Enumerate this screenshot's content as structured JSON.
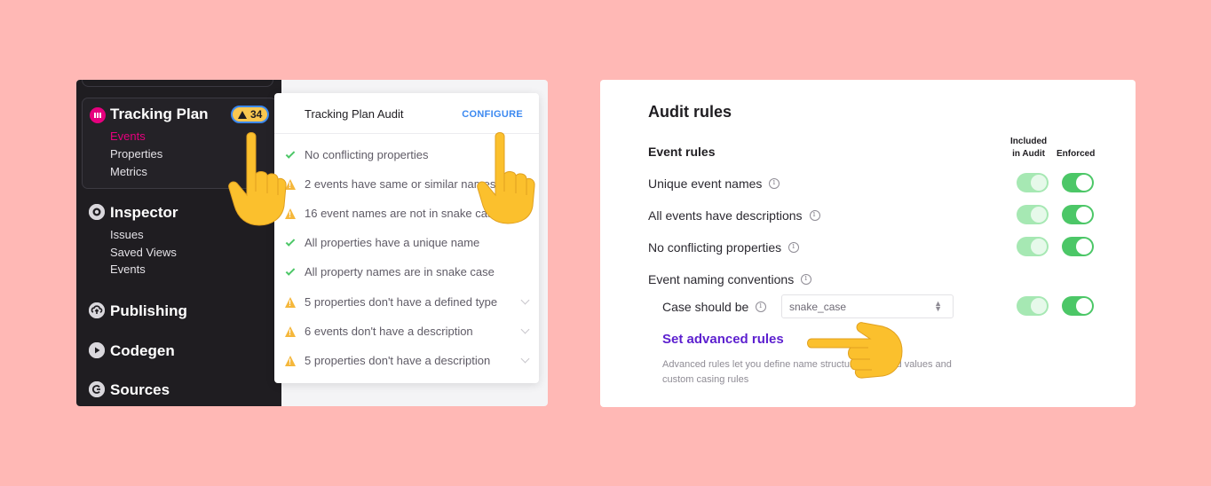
{
  "sidebar": {
    "tracking_plan": {
      "title": "Tracking Plan",
      "badge_count": "34",
      "items": [
        "Events",
        "Properties",
        "Metrics"
      ]
    },
    "inspector": {
      "title": "Inspector",
      "items": [
        "Issues",
        "Saved Views",
        "Events"
      ]
    },
    "publishing": {
      "title": "Publishing"
    },
    "codegen": {
      "title": "Codegen"
    },
    "sources": {
      "title": "Sources"
    }
  },
  "audit": {
    "title": "Tracking Plan Audit",
    "configure": "CONFIGURE",
    "rows": [
      {
        "status": "pass",
        "text": "No conflicting properties"
      },
      {
        "status": "warn",
        "text": "2 events have same or similar names"
      },
      {
        "status": "warn",
        "text": "16 event names are not in snake case"
      },
      {
        "status": "pass",
        "text": "All properties have a unique name"
      },
      {
        "status": "pass",
        "text": "All property names are in snake case"
      },
      {
        "status": "warn",
        "text": "5 properties don't have a defined type"
      },
      {
        "status": "warn",
        "text": "6 events don't have a description"
      },
      {
        "status": "warn",
        "text": "5 properties don't have a description"
      }
    ]
  },
  "rules": {
    "title": "Audit rules",
    "subtitle": "Event rules",
    "col_included_1": "Included",
    "col_included_2": "in Audit",
    "col_enforced": "Enforced",
    "items": [
      {
        "label": "Unique event names",
        "included": true,
        "enforced": true
      },
      {
        "label": "All events have descriptions",
        "included": true,
        "enforced": true
      },
      {
        "label": "No conflicting properties",
        "included": true,
        "enforced": true
      },
      {
        "label": "Event naming conventions"
      }
    ],
    "case_label": "Case should be",
    "case_value": "snake_case",
    "advanced_link": "Set advanced rules",
    "advanced_desc": "Advanced rules let you define name structures, allowed values and custom casing rules"
  },
  "colors": {
    "background": "#FFB8B5",
    "sidebar": "#1F1D21",
    "accent_pink": "#E6007E",
    "accent_blue": "#3C89F0",
    "accent_purple": "#5C1FCF",
    "toggle_green": "#4CC767",
    "warning": "#F5B73B"
  },
  "icons": {
    "tracking_plan": "tracking-plan-icon",
    "inspector": "inspector-icon",
    "publishing": "cloud-upload-icon",
    "codegen": "play-icon",
    "sources": "sources-icon",
    "pointer": "pointing-hand-icon"
  }
}
